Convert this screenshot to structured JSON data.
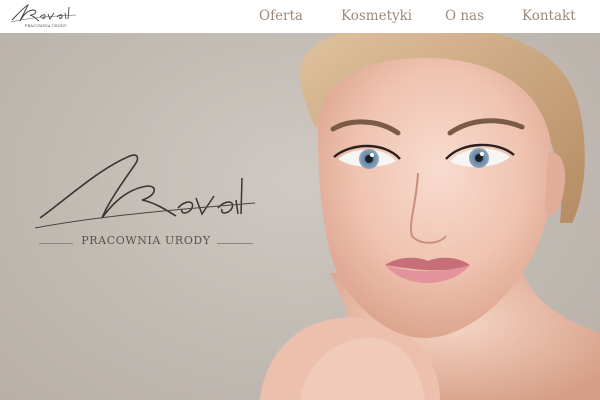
{
  "header": {
    "brand_small": "PRACOWNIA URODY"
  },
  "nav": {
    "items": [
      {
        "label": "Oferta"
      },
      {
        "label": "Kosmetyki"
      },
      {
        "label": "O nas"
      },
      {
        "label": "Kontakt"
      }
    ]
  },
  "hero": {
    "tagline": "PRACOWNIA URODY",
    "colors": {
      "background": "#c4bdb6",
      "skin": "#f2cbbb",
      "lips": "#d7868a",
      "eyes": "#6f8aa6",
      "hair": "#c9a47c",
      "nav_text": "#9a8a7c"
    }
  }
}
